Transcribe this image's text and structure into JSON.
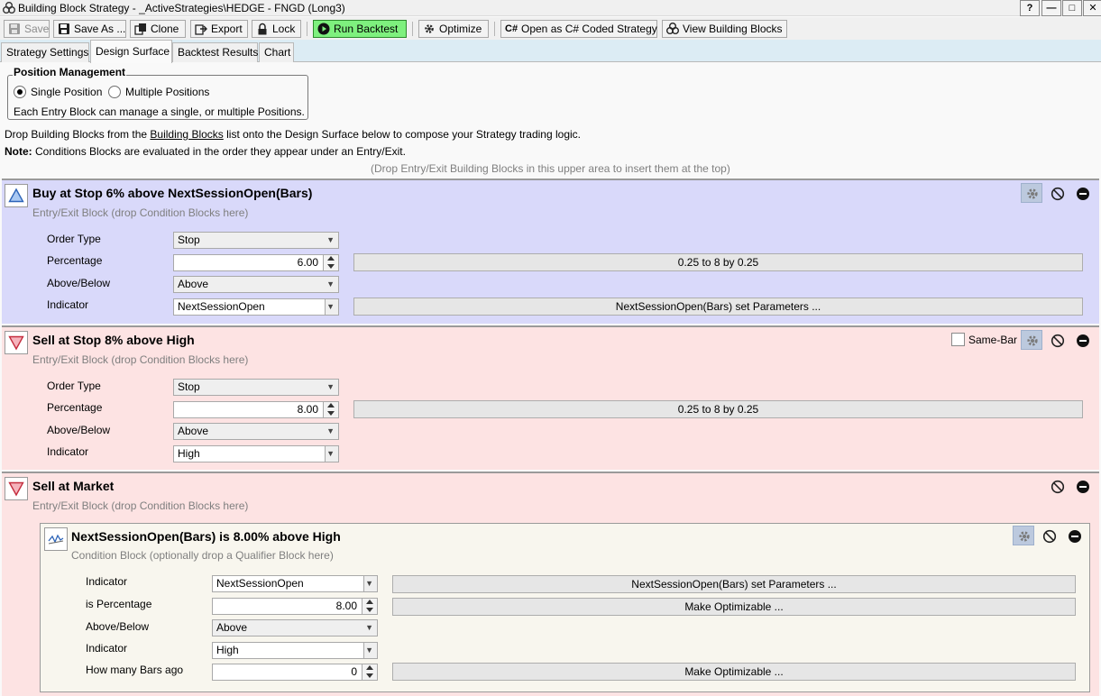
{
  "window": {
    "title": "Building Block Strategy - _ActiveStrategies\\HEDGE - FNGD (Long3)",
    "buttons": {
      "help": "?",
      "minimize": "—",
      "maximize": "□",
      "close": "✕"
    }
  },
  "toolbar": {
    "save": "Save",
    "save_as": "Save As ...",
    "clone": "Clone",
    "export": "Export",
    "lock": "Lock",
    "run_backtest": "Run Backtest",
    "optimize": "Optimize",
    "open_csharp": "Open as C# Coded Strategy",
    "view_blocks": "View Building Blocks"
  },
  "tabs": [
    "Strategy Settings",
    "Design Surface",
    "Backtest Results",
    "Chart"
  ],
  "position_management": {
    "title": "Position Management",
    "single": "Single Position",
    "multiple": "Multiple Positions",
    "selected": "Single Position",
    "description": "Each Entry Block can manage a single, or multiple Positions."
  },
  "instructions": {
    "line1_pre": "Drop Building Blocks from the ",
    "line1_link": "Building Blocks",
    "line1_post": " list onto the Design Surface below to compose your Strategy trading logic.",
    "note_label": "Note:",
    "note_text": " Conditions Blocks are evaluated in the order they appear under an Entry/Exit.",
    "drop_hint": "(Drop Entry/Exit Building Blocks in this upper area to insert them at the top)"
  },
  "blocks": [
    {
      "title": "Buy at Stop 6% above NextSessionOpen(Bars)",
      "subtitle": "Entry/Exit Block (drop Condition Blocks here)",
      "labels": {
        "order_type": "Order Type",
        "percentage": "Percentage",
        "above_below": "Above/Below",
        "indicator": "Indicator"
      },
      "values": {
        "order_type": "Stop",
        "percentage": "6.00",
        "above_below": "Above",
        "indicator": "NextSessionOpen"
      },
      "range": "0.25 to 8 by 0.25",
      "params_button": "NextSessionOpen(Bars) set Parameters ..."
    },
    {
      "title": "Sell at Stop 8% above High",
      "subtitle": "Entry/Exit Block (drop Condition Blocks here)",
      "same_bar": "Same-Bar",
      "labels": {
        "order_type": "Order Type",
        "percentage": "Percentage",
        "above_below": "Above/Below",
        "indicator": "Indicator"
      },
      "values": {
        "order_type": "Stop",
        "percentage": "8.00",
        "above_below": "Above",
        "indicator": "High"
      },
      "range": "0.25 to 8 by 0.25"
    },
    {
      "title": "Sell at Market",
      "subtitle": "Entry/Exit Block (drop Condition Blocks here)",
      "condition": {
        "title": "NextSessionOpen(Bars) is 8.00% above High",
        "subtitle": "Condition Block (optionally drop a Qualifier Block here)",
        "labels": {
          "indicator": "Indicator",
          "is_percentage": "is Percentage",
          "above_below": "Above/Below",
          "indicator2": "Indicator",
          "bars_ago": "How many Bars ago"
        },
        "values": {
          "indicator": "NextSessionOpen",
          "is_percentage": "8.00",
          "above_below": "Above",
          "indicator2": "High",
          "bars_ago": "0"
        },
        "params_button": "NextSessionOpen(Bars) set Parameters ...",
        "optimizable1": "Make Optimizable ...",
        "optimizable2": "Make Optimizable ..."
      }
    }
  ]
}
